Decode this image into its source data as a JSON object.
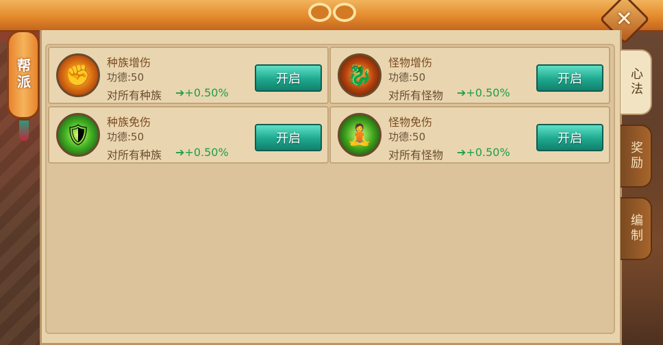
{
  "close_label": "✕",
  "left_tab": {
    "label": "帮派"
  },
  "right_tabs": [
    {
      "label": "心法",
      "active": true
    },
    {
      "label": "奖励",
      "active": false
    },
    {
      "label": "编制",
      "active": false
    }
  ],
  "cards": [
    {
      "name": "种族增伤",
      "merit": "功德:50",
      "desc": "对所有种族",
      "bonus": "+0.50%",
      "button": "开启",
      "icon": "fist-icon"
    },
    {
      "name": "怪物增伤",
      "merit": "功德:50",
      "desc": "对所有怪物",
      "bonus": "+0.50%",
      "button": "开启",
      "icon": "dragon-icon"
    },
    {
      "name": "种族免伤",
      "merit": "功德:50",
      "desc": "对所有种族",
      "bonus": "+0.50%",
      "button": "开启",
      "icon": "shield-icon"
    },
    {
      "name": "怪物免伤",
      "merit": "功德:50",
      "desc": "对所有怪物",
      "bonus": "+0.50%",
      "button": "开启",
      "icon": "monk-icon"
    }
  ],
  "colors": {
    "button": "#1ea88e",
    "bonus": "#1f9e44",
    "header": "#e48a2c"
  }
}
